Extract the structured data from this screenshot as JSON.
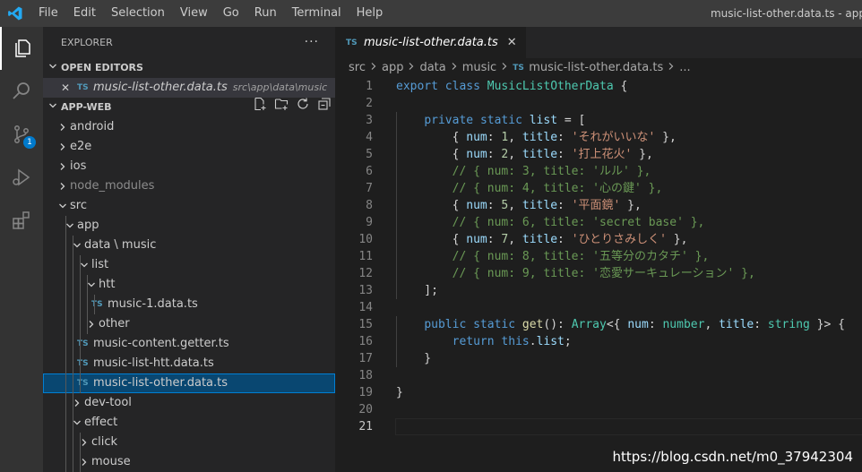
{
  "menu": [
    "File",
    "Edit",
    "Selection",
    "View",
    "Go",
    "Run",
    "Terminal",
    "Help"
  ],
  "window_title": "music-list-other.data.ts - app",
  "activity": {
    "scm_badge": "1"
  },
  "explorer": {
    "title": "EXPLORER",
    "more": "···",
    "open_editors_label": "OPEN EDITORS",
    "open_editor": {
      "icon": "TS",
      "name": "music-list-other.data.ts",
      "path": "src\\app\\data\\music"
    },
    "workspace_label": "APP-WEB",
    "tree": [
      {
        "label": "android",
        "depth": 0,
        "type": "folder",
        "open": false
      },
      {
        "label": "e2e",
        "depth": 0,
        "type": "folder",
        "open": false
      },
      {
        "label": "ios",
        "depth": 0,
        "type": "folder",
        "open": false
      },
      {
        "label": "node_modules",
        "depth": 0,
        "type": "folder",
        "open": false,
        "dim": true
      },
      {
        "label": "src",
        "depth": 0,
        "type": "folder",
        "open": true
      },
      {
        "label": "app",
        "depth": 1,
        "type": "folder",
        "open": true
      },
      {
        "label": "data \\ music",
        "depth": 2,
        "type": "folder",
        "open": true
      },
      {
        "label": "list",
        "depth": 3,
        "type": "folder",
        "open": true
      },
      {
        "label": "htt",
        "depth": 4,
        "type": "folder",
        "open": true
      },
      {
        "label": "music-1.data.ts",
        "depth": 5,
        "type": "file",
        "icon": "TS"
      },
      {
        "label": "other",
        "depth": 4,
        "type": "folder",
        "open": false
      },
      {
        "label": "music-content.getter.ts",
        "depth": 3,
        "type": "file",
        "icon": "TS"
      },
      {
        "label": "music-list-htt.data.ts",
        "depth": 3,
        "type": "file",
        "icon": "TS"
      },
      {
        "label": "music-list-other.data.ts",
        "depth": 3,
        "type": "file",
        "icon": "TS",
        "selected": true
      },
      {
        "label": "dev-tool",
        "depth": 2,
        "type": "folder",
        "open": false
      },
      {
        "label": "effect",
        "depth": 2,
        "type": "folder",
        "open": true
      },
      {
        "label": "click",
        "depth": 3,
        "type": "folder",
        "open": false
      },
      {
        "label": "mouse",
        "depth": 3,
        "type": "folder",
        "open": false
      }
    ]
  },
  "tab": {
    "icon": "TS",
    "label": "music-list-other.data.ts",
    "close": "✕"
  },
  "breadcrumbs": [
    "src",
    "app",
    "data",
    "music",
    "music-list-other.data.ts",
    "..."
  ],
  "breadcrumb_file_icon": "TS",
  "code_lines": [
    [
      [
        "kw",
        "export"
      ],
      [
        "pun",
        " "
      ],
      [
        "kw",
        "class"
      ],
      [
        "pun",
        " "
      ],
      [
        "cls",
        "MusicListOtherData"
      ],
      [
        "pun",
        " {"
      ]
    ],
    [],
    [
      [
        "pun",
        "    "
      ],
      [
        "kw",
        "private"
      ],
      [
        "pun",
        " "
      ],
      [
        "kw",
        "static"
      ],
      [
        "pun",
        " "
      ],
      [
        "prop",
        "list"
      ],
      [
        "pun",
        " = ["
      ]
    ],
    [
      [
        "pun",
        "        { "
      ],
      [
        "prop",
        "num"
      ],
      [
        "pun",
        ": "
      ],
      [
        "num",
        "1"
      ],
      [
        "pun",
        ", "
      ],
      [
        "prop",
        "title"
      ],
      [
        "pun",
        ": "
      ],
      [
        "str",
        "'それがいいな'"
      ],
      [
        "pun",
        " },"
      ]
    ],
    [
      [
        "pun",
        "        { "
      ],
      [
        "prop",
        "num"
      ],
      [
        "pun",
        ": "
      ],
      [
        "num",
        "2"
      ],
      [
        "pun",
        ", "
      ],
      [
        "prop",
        "title"
      ],
      [
        "pun",
        ": "
      ],
      [
        "str",
        "'打上花火'"
      ],
      [
        "pun",
        " },"
      ]
    ],
    [
      [
        "pun",
        "        "
      ],
      [
        "com",
        "// { num: 3, title: 'ルル' },"
      ]
    ],
    [
      [
        "pun",
        "        "
      ],
      [
        "com",
        "// { num: 4, title: '心の鍵' },"
      ]
    ],
    [
      [
        "pun",
        "        { "
      ],
      [
        "prop",
        "num"
      ],
      [
        "pun",
        ": "
      ],
      [
        "num",
        "5"
      ],
      [
        "pun",
        ", "
      ],
      [
        "prop",
        "title"
      ],
      [
        "pun",
        ": "
      ],
      [
        "str",
        "'平面鏡'"
      ],
      [
        "pun",
        " },"
      ]
    ],
    [
      [
        "pun",
        "        "
      ],
      [
        "com",
        "// { num: 6, title: 'secret base' },"
      ]
    ],
    [
      [
        "pun",
        "        { "
      ],
      [
        "prop",
        "num"
      ],
      [
        "pun",
        ": "
      ],
      [
        "num",
        "7"
      ],
      [
        "pun",
        ", "
      ],
      [
        "prop",
        "title"
      ],
      [
        "pun",
        ": "
      ],
      [
        "str",
        "'ひとりさみしく'"
      ],
      [
        "pun",
        " },"
      ]
    ],
    [
      [
        "pun",
        "        "
      ],
      [
        "com",
        "// { num: 8, title: '五等分のカタチ' },"
      ]
    ],
    [
      [
        "pun",
        "        "
      ],
      [
        "com",
        "// { num: 9, title: '恋愛サーキュレーション' },"
      ]
    ],
    [
      [
        "pun",
        "    ];"
      ]
    ],
    [],
    [
      [
        "pun",
        "    "
      ],
      [
        "kw",
        "public"
      ],
      [
        "pun",
        " "
      ],
      [
        "kw",
        "static"
      ],
      [
        "pun",
        " "
      ],
      [
        "fn",
        "get"
      ],
      [
        "pun",
        "(): "
      ],
      [
        "cls",
        "Array"
      ],
      [
        "pun",
        "<{ "
      ],
      [
        "prop",
        "num"
      ],
      [
        "pun",
        ": "
      ],
      [
        "cls",
        "number"
      ],
      [
        "pun",
        ", "
      ],
      [
        "prop",
        "title"
      ],
      [
        "pun",
        ": "
      ],
      [
        "cls",
        "string"
      ],
      [
        "pun",
        " }> {"
      ]
    ],
    [
      [
        "pun",
        "        "
      ],
      [
        "kw",
        "return"
      ],
      [
        "pun",
        " "
      ],
      [
        "kw",
        "this"
      ],
      [
        "pun",
        "."
      ],
      [
        "prop",
        "list"
      ],
      [
        "pun",
        ";"
      ]
    ],
    [
      [
        "pun",
        "    }"
      ]
    ],
    [],
    [
      [
        "pun",
        "}"
      ]
    ],
    [],
    []
  ],
  "current_line": 21,
  "watermark": "https://blog.csdn.net/m0_37942304",
  "colors": {
    "accent": "#007acc",
    "selection": "#094771",
    "ts_icon": "#519aba"
  }
}
